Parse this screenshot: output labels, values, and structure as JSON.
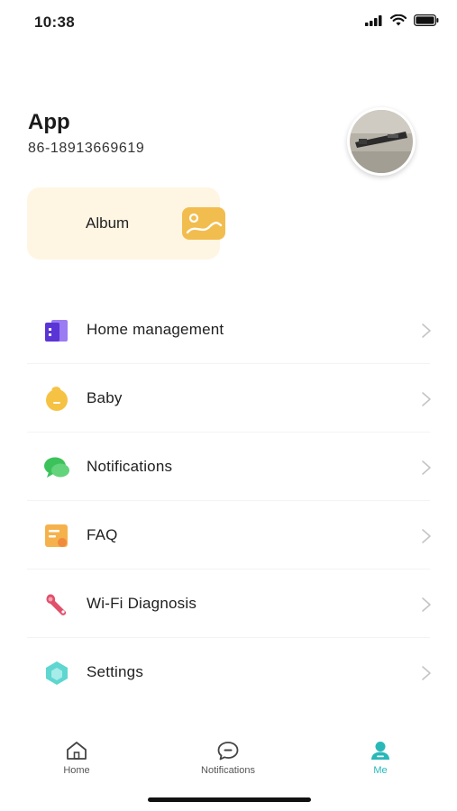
{
  "status_bar": {
    "time": "10:38"
  },
  "profile": {
    "name": "App",
    "phone": "86-18913669619"
  },
  "album": {
    "label": "Album"
  },
  "menu": {
    "items": [
      {
        "label": "Home management",
        "icon": "building-icon"
      },
      {
        "label": "Baby",
        "icon": "baby-face-icon"
      },
      {
        "label": "Notifications",
        "icon": "chat-bubbles-icon"
      },
      {
        "label": "FAQ",
        "icon": "faq-document-icon"
      },
      {
        "label": "Wi-Fi Diagnosis",
        "icon": "wrench-icon"
      },
      {
        "label": "Settings",
        "icon": "hexagon-settings-icon"
      }
    ]
  },
  "tab_bar": {
    "tabs": [
      {
        "label": "Home",
        "icon": "house-icon",
        "active": false
      },
      {
        "label": "Notifications",
        "icon": "message-bubble-icon",
        "active": false
      },
      {
        "label": "Me",
        "icon": "person-icon",
        "active": true
      }
    ]
  },
  "colors": {
    "accent": "#29b8b8",
    "album_card_bg": "#fff5e3",
    "album_icon": "#f2bd4f",
    "home_icon": "#6a46e0",
    "baby_icon": "#f6c244",
    "notifications_icon": "#3cc25a",
    "faq_icon": "#f5b24c",
    "wifi_icon": "#e0506a",
    "settings_icon": "#5fd6d0"
  }
}
